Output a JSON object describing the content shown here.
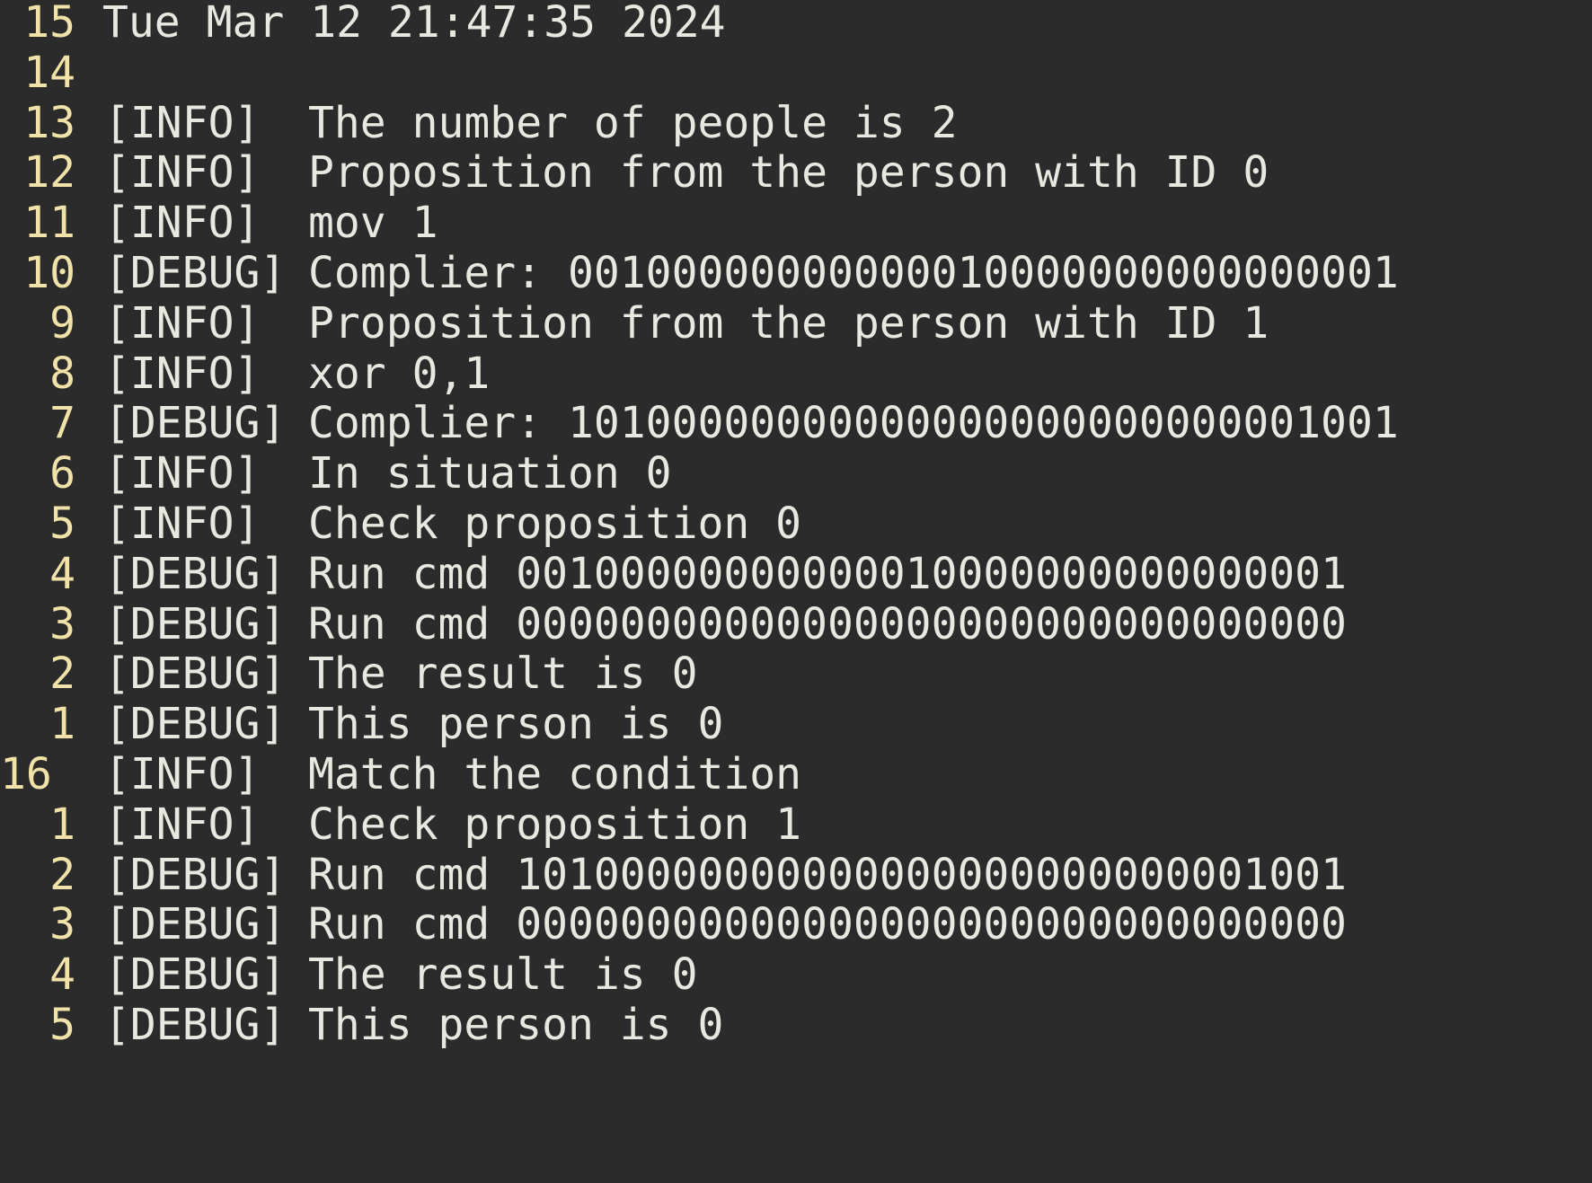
{
  "editor": {
    "lines": [
      {
        "num": "15",
        "tag": "",
        "text": "Tue Mar 12 21:47:35 2024"
      },
      {
        "num": "14",
        "tag": "",
        "text": ""
      },
      {
        "num": "13",
        "tag": "[INFO]",
        "text": "The number of people is 2"
      },
      {
        "num": "12",
        "tag": "[INFO]",
        "text": "Proposition from the person with ID 0"
      },
      {
        "num": "11",
        "tag": "[INFO]",
        "text": "mov 1"
      },
      {
        "num": "10",
        "tag": "[DEBUG]",
        "text": "Complier: 00100000000000010000000000000001"
      },
      {
        "num": "9",
        "tag": "[INFO]",
        "text": "Proposition from the person with ID 1"
      },
      {
        "num": "8",
        "tag": "[INFO]",
        "text": "xor 0,1"
      },
      {
        "num": "7",
        "tag": "[DEBUG]",
        "text": "Complier: 10100000000000000000000000001001"
      },
      {
        "num": "6",
        "tag": "[INFO]",
        "text": "In situation 0"
      },
      {
        "num": "5",
        "tag": "[INFO]",
        "text": "Check proposition 0"
      },
      {
        "num": "4",
        "tag": "[DEBUG]",
        "text": "Run cmd 00100000000000010000000000000001"
      },
      {
        "num": "3",
        "tag": "[DEBUG]",
        "text": "Run cmd 00000000000000000000000000000000"
      },
      {
        "num": "2",
        "tag": "[DEBUG]",
        "text": "The result is 0"
      },
      {
        "num": "1",
        "tag": "[DEBUG]",
        "text": "This person is 0"
      },
      {
        "num": "16",
        "tag": "[INFO]",
        "text": "Match the condition",
        "current": true
      },
      {
        "num": "1",
        "tag": "[INFO]",
        "text": "Check proposition 1"
      },
      {
        "num": "2",
        "tag": "[DEBUG]",
        "text": "Run cmd 10100000000000000000000000001001"
      },
      {
        "num": "3",
        "tag": "[DEBUG]",
        "text": "Run cmd 00000000000000000000000000000000"
      },
      {
        "num": "4",
        "tag": "[DEBUG]",
        "text": "The result is 0"
      },
      {
        "num": "5",
        "tag": "[DEBUG]",
        "text": "This person is 0"
      }
    ]
  }
}
